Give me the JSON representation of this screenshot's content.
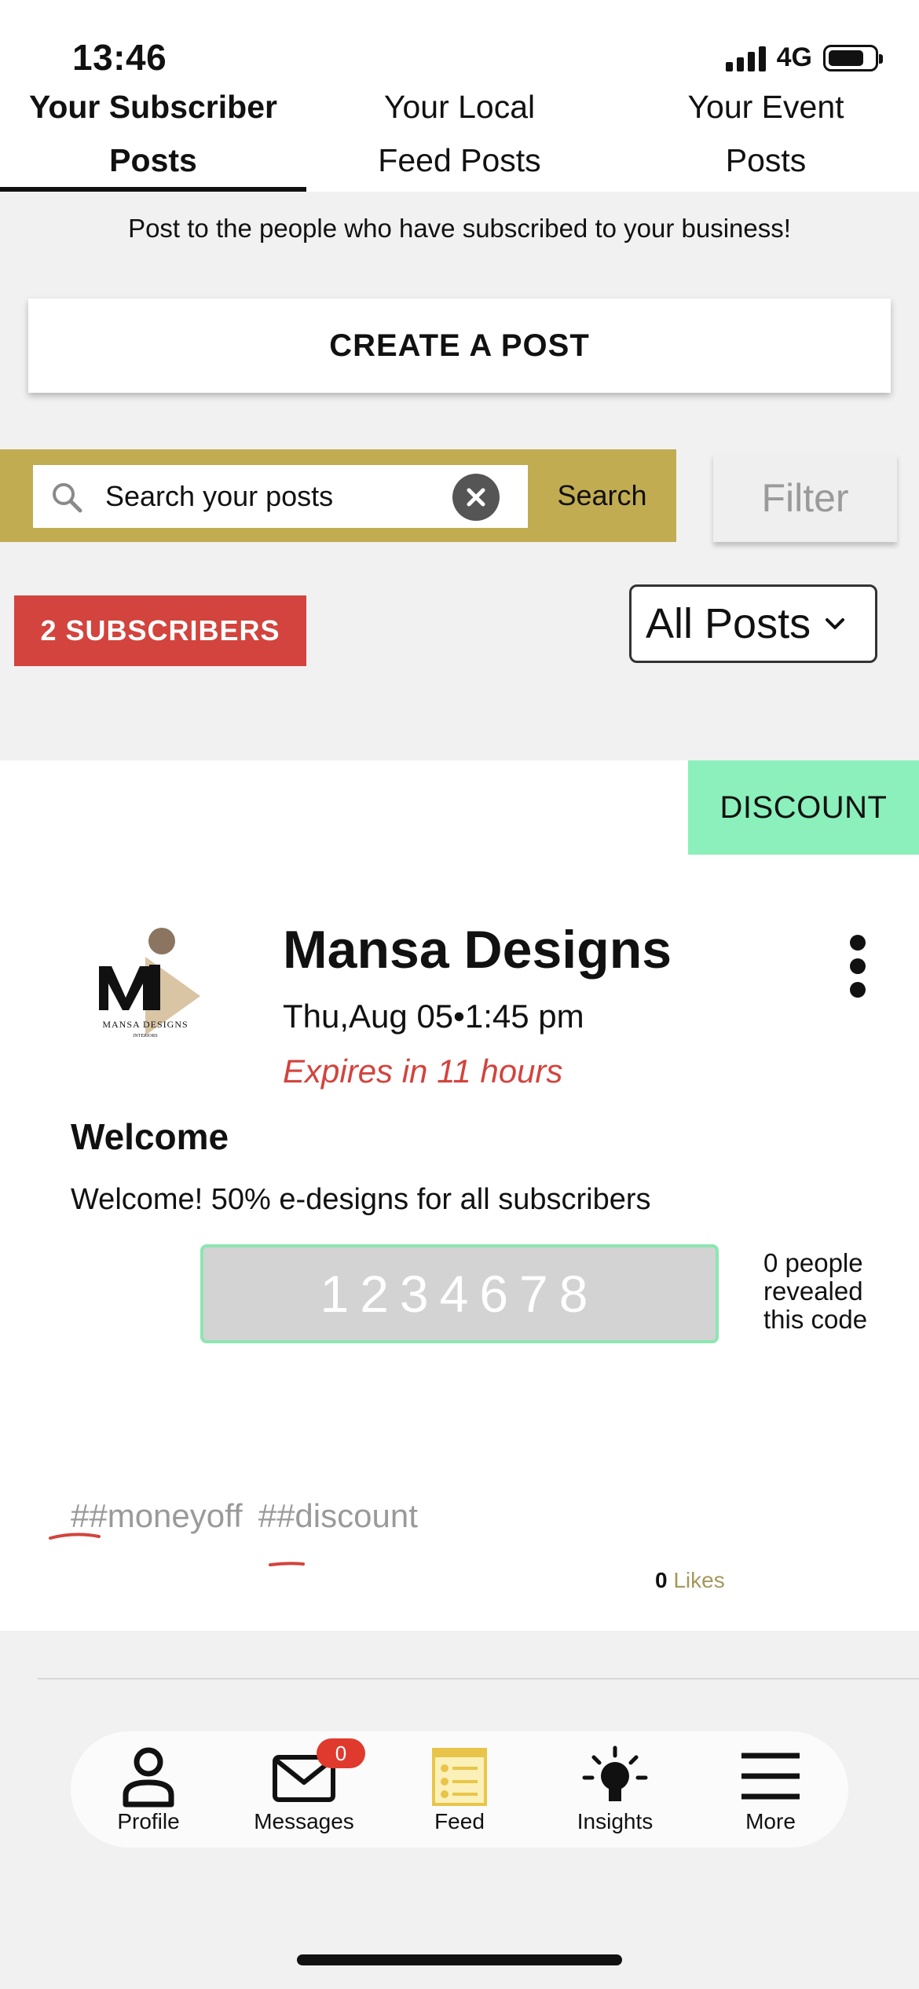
{
  "status": {
    "time": "13:46",
    "network": "4G"
  },
  "tabs": [
    {
      "line1": "Your Subscriber",
      "line2": "Posts"
    },
    {
      "line1": "Your Local",
      "line2": "Feed Posts"
    },
    {
      "line1": "Your Event",
      "line2": "Posts"
    }
  ],
  "intro_text": "Post to the people who have subscribed to your business!",
  "create_button": "CREATE A POST",
  "search": {
    "placeholder": "Search your posts",
    "value": "Search your posts",
    "button": "Search"
  },
  "filter_button": "Filter",
  "subscribers_button": "2 SUBSCRIBERS",
  "posts_select": {
    "selected": "All Posts"
  },
  "post": {
    "badge": "DISCOUNT",
    "business_name": "Mansa Designs",
    "date": "Thu,Aug 05•1:45 pm",
    "expires": "Expires in 11 hours",
    "title": "Welcome",
    "body": "Welcome! 50% e-designs for all subscribers",
    "code": "1234678",
    "revealed": "0 people revealed this code",
    "tags": [
      "##moneyoff",
      "##discount"
    ],
    "likes_count": "0",
    "likes_label": "Likes",
    "logo_text": "MANSA DESIGNS",
    "logo_subtext": "INTERIORS"
  },
  "tabbar": {
    "items": [
      {
        "label": "Profile",
        "icon": "person-icon"
      },
      {
        "label": "Messages",
        "icon": "envelope-icon",
        "badge": "0"
      },
      {
        "label": "Feed",
        "icon": "feed-icon"
      },
      {
        "label": "Insights",
        "icon": "lightbulb-icon"
      },
      {
        "label": "More",
        "icon": "hamburger-menu-icon"
      }
    ]
  },
  "colors": {
    "accent_gold": "#c2ac52",
    "subscribers_red": "#d2443d",
    "discount_green": "#8bf0bb",
    "badge_red": "#e03a2e"
  }
}
